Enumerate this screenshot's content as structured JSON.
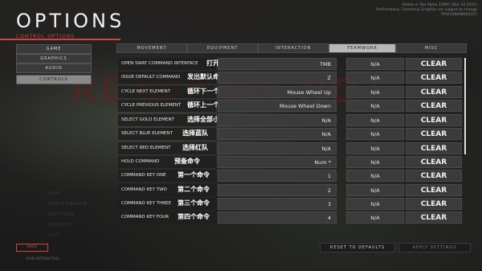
{
  "header": {
    "title": "OPTIONS",
    "subtitle": "CONTROL OPTIONS",
    "build_line1": "Ready or Not Alpha 15697 (Dec 14 2021)",
    "build_line2": "Performance, Content & Graphics are subject to change",
    "build_line3": "7656198848902357"
  },
  "background_word": "READY OR NOT",
  "sidebar": [
    {
      "label": "GAME"
    },
    {
      "label": "GRAPHICS"
    },
    {
      "label": "AUDIO"
    },
    {
      "label": "CONTROLS"
    }
  ],
  "tabs": [
    {
      "label": "MOVEMENT"
    },
    {
      "label": "EQUIPMENT"
    },
    {
      "label": "INTERACTION"
    },
    {
      "label": "TEAMWORK"
    },
    {
      "label": "MISC"
    }
  ],
  "rows": [
    {
      "label": "OPEN SWAT COMMAND INTERFACE",
      "cn": "打开swat命令界面",
      "primary": "TMB",
      "secondary": "N/A",
      "clear": "CLEAR"
    },
    {
      "label": "ISSUE DEFAULT COMMAND",
      "cn": "发出默认命令",
      "primary": "Z",
      "secondary": "N/A",
      "clear": "CLEAR"
    },
    {
      "label": "CYCLE NEXT ELEMENT",
      "cn": "循环下一个小队",
      "primary": "Mouse Wheel Up",
      "secondary": "N/A",
      "clear": "CLEAR"
    },
    {
      "label": "CYCLE PREVIOUS ELEMENT",
      "cn": "循环上一个小队",
      "primary": "Mouse Wheel Down",
      "secondary": "N/A",
      "clear": "CLEAR"
    },
    {
      "label": "SELECT GOLD ELEMENT",
      "cn": "选择全部小队",
      "primary": "N/A",
      "secondary": "N/A",
      "clear": "CLEAR"
    },
    {
      "label": "SELECT BLUE ELEMENT",
      "cn": "选择蓝队",
      "primary": "N/A",
      "secondary": "N/A",
      "clear": "CLEAR"
    },
    {
      "label": "SELECT RED ELEMENT",
      "cn": "选择红队",
      "primary": "N/A",
      "secondary": "N/A",
      "clear": "CLEAR"
    },
    {
      "label": "HOLD COMMAND",
      "cn": "预备命令",
      "primary": "Num *",
      "secondary": "N/A",
      "clear": "CLEAR"
    },
    {
      "label": "COMMAND KEY ONE",
      "cn": "第一个命令",
      "primary": "1",
      "secondary": "N/A",
      "clear": "CLEAR"
    },
    {
      "label": "COMMAND KEY TWO",
      "cn": "第二个命令",
      "primary": "2",
      "secondary": "N/A",
      "clear": "CLEAR"
    },
    {
      "label": "COMMAND KEY THREE",
      "cn": "第三个命令",
      "primary": "3",
      "secondary": "N/A",
      "clear": "CLEAR"
    },
    {
      "label": "COMMAND KEY FOUR",
      "cn": "第四个命令",
      "primary": "4",
      "secondary": "N/A",
      "clear": "CLEAR"
    }
  ],
  "faded_menu": [
    "PLAY",
    "PERFORMANCE",
    "SETTINGS",
    "CREDITS",
    "EXIT"
  ],
  "footer": {
    "back_label": "BACK",
    "copyright": "VOID INTERACTIVE",
    "reset_label": "RESET TO DEFAULTS",
    "apply_label": "APPLY SETTINGS"
  },
  "colors": {
    "accent": "#c9473d",
    "active_tab": "#b8b8b8",
    "button": "#3b3b3b"
  }
}
